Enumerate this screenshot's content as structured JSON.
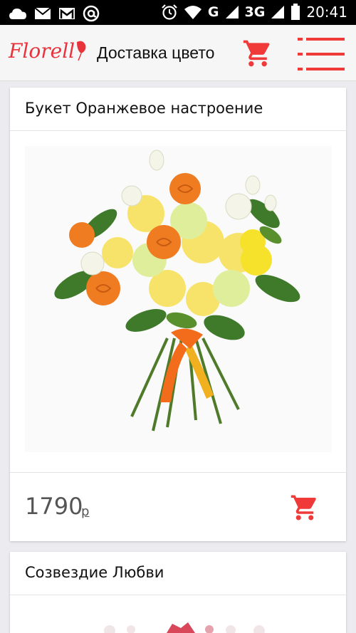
{
  "status_bar": {
    "network_label": "G",
    "network_3g_label": "3G",
    "time": "20:41"
  },
  "header": {
    "logo_text": "Florell",
    "title": "Доставка цвето",
    "cart_icon": "shopping-cart-icon",
    "menu_icon": "hamburger-menu-icon"
  },
  "products": [
    {
      "name": "Букет Оранжевое настроение",
      "price": "1790",
      "currency": "р",
      "image_icon": "bouquet-image"
    },
    {
      "name": "Созвездие Любви"
    }
  ],
  "colors": {
    "accent": "#f03a3a",
    "status_bar": "#000000",
    "app_bar": "#f6f6f7",
    "page_bg": "#ececf0",
    "price_text": "#555555"
  }
}
